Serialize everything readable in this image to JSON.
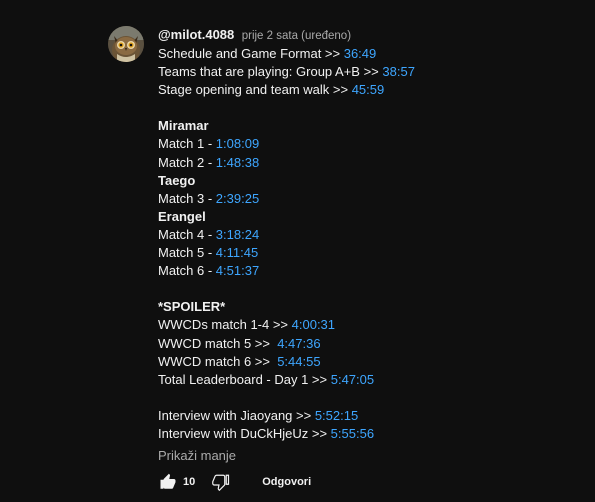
{
  "comment": {
    "author": "@milot.4088",
    "time": "prije 2 sata (uređeno)",
    "lines": [
      {
        "text": "Schedule and Game Format >> ",
        "ts": "36:49",
        "bold": false
      },
      {
        "text": "Teams that are playing: Group A+B >> ",
        "ts": "38:57",
        "bold": false
      },
      {
        "text": "Stage opening and team walk >> ",
        "ts": "45:59",
        "bold": false
      },
      {
        "text": "",
        "ts": "",
        "bold": false
      },
      {
        "text": "Miramar",
        "ts": "",
        "bold": true
      },
      {
        "text": "Match 1 - ",
        "ts": "1:08:09",
        "bold": false
      },
      {
        "text": "Match 2 - ",
        "ts": "1:48:38",
        "bold": false
      },
      {
        "text": "Taego",
        "ts": "",
        "bold": true
      },
      {
        "text": "Match 3 - ",
        "ts": "2:39:25",
        "bold": false
      },
      {
        "text": "Erangel",
        "ts": "",
        "bold": true
      },
      {
        "text": "Match 4 - ",
        "ts": "3:18:24",
        "bold": false
      },
      {
        "text": "Match 5 - ",
        "ts": "4:11:45",
        "bold": false
      },
      {
        "text": "Match 6 - ",
        "ts": "4:51:37",
        "bold": false
      },
      {
        "text": "",
        "ts": "",
        "bold": false
      },
      {
        "text": "*SPOILER*",
        "ts": "",
        "bold": true
      },
      {
        "text": "WWCDs match 1-4 >> ",
        "ts": "4:00:31",
        "bold": false
      },
      {
        "text": "WWCD match 5 >>  ",
        "ts": "4:47:36",
        "bold": false
      },
      {
        "text": "WWCD match 6 >>  ",
        "ts": "5:44:55",
        "bold": false
      },
      {
        "text": "Total Leaderboard - Day 1 >> ",
        "ts": "5:47:05",
        "bold": false
      },
      {
        "text": "",
        "ts": "",
        "bold": false
      },
      {
        "text": "Interview with Jiaoyang >> ",
        "ts": "5:52:15",
        "bold": false
      },
      {
        "text": "Interview with DuCkHjeUz >> ",
        "ts": "5:55:56",
        "bold": false
      }
    ],
    "show_less": "Prikaži manje",
    "like_count": "10",
    "reply": "Odgovori"
  },
  "icons": {
    "avatar": "owl-avatar",
    "like": "thumbs-up-icon",
    "dislike": "thumbs-down-icon"
  },
  "colors": {
    "background": "#0f0f0f",
    "text": "#f1f1f1",
    "secondary": "#aaaaaa",
    "link": "#3ea6ff"
  }
}
